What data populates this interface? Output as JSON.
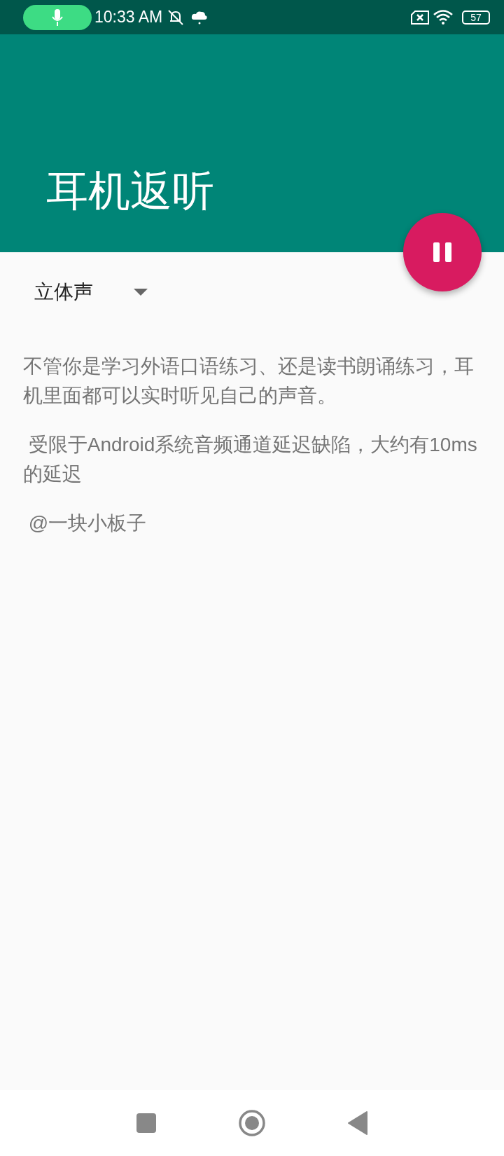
{
  "status_bar": {
    "time": "10:33 AM",
    "battery": "57"
  },
  "toolbar": {
    "title": "耳机返听"
  },
  "fab": {
    "playing": true
  },
  "dropdown": {
    "value": "立体声"
  },
  "paragraphs": [
    "不管你是学习外语口语练习、还是读书朗诵练习，耳机里面都可以实时听见自己的声音。",
    " 受限于Android系统音频通道延迟缺陷，大约有10ms的延迟",
    " @一块小板子"
  ]
}
